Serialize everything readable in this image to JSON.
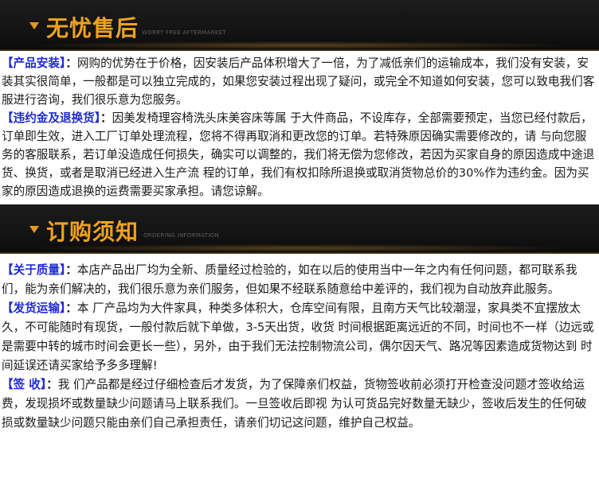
{
  "banner1": {
    "title": "无忧售后",
    "subtitle": "WORRY FREE AFTERMARKET"
  },
  "banner2": {
    "title": "订购须知",
    "subtitle": "ORDERING INFORMATION"
  },
  "section1": {
    "paragraphs": [
      {
        "label": "【产品安装】",
        "sep": "：",
        "text": "网购的优势在于价格，因安装后产品体积增大了一倍，为了减低亲们的运输成本，我们没有安装，安装其实很简单，一般都是可以独立完成的，如果您安装过程出现了疑问，或完全不知道如何安装，您可以致电我们客服进行咨询，我们很乐意为您服务。"
      },
      {
        "label": "【违约金及退换货】",
        "sep": "：",
        "text": "因美发椅理容椅洗头床美容床等属 于大件商品，不设库存，全部需要预定，当您已经付款后，订单即生效，进入工厂订单处理流程，您将不得再取消和更改您的订单。若特殊原因确实需要修改的，请 与向您服务的客服联系，若订单没造成任何损失，确实可以调整的，我们将无偿为您修改，若因为买家自身的原因造成中途退货、换货，或者是取消已经进入生产流 程的订单，我们有权扣除所退换或取消货物总价的30%作为违约金。因为买家的原因造成退换的运费需要买家承担。请您谅解。"
      }
    ]
  },
  "section2": {
    "paragraphs": [
      {
        "label": "【关于质量】",
        "sep": "：",
        "text": "本店产品出厂均为全新、质量经过检验的，如在以后的使用当中一年之内有任何问题，都可联系我们，能为亲们解决的，我们很乐意为亲们服务，但如果不经联系随意给中差评的，我们视为自动放弃此服务。"
      },
      {
        "label": "【发货运输】",
        "sep": "：",
        "text": "本 厂产品均为大件家具，种类多体积大，仓库空间有限，且南方天气比较潮湿，家具类不宜摆放太久，不可能随时有现货，一般付款后就下单做，3-5天出货，收货 时间根据距离远近的不同，时间也不一样（边远或是需要中转的城市时间会更长一些），另外，由于我们无法控制物流公司，偶尔因天气、路况等因素造成货物达到 时间延误还请买家给予多多理解!"
      },
      {
        "label": "【签  收】",
        "sep": "：",
        "text": "我 们产品都是经过仔细检查后才发货，为了保障亲们权益，货物签收前必须打开检查没问题才签收给运费，发现损坏或数量缺少问题请马上联系我们。一旦签收后即视 为认可货品完好数量无缺少，签收后发生的任何破损或数量缺少问题只能由亲们自己承担责任，请亲们切记这问题，维护自己权益。"
      }
    ]
  }
}
